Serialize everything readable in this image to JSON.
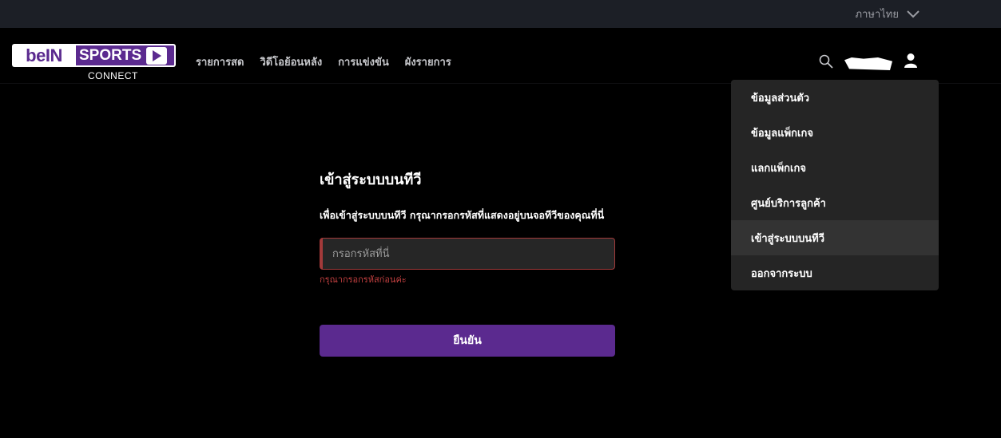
{
  "topbar": {
    "language": "ภาษาไทย"
  },
  "logo": {
    "left_text": "beIN",
    "right_text": "SPORTS",
    "sub_text": "CONNECT"
  },
  "nav": [
    {
      "label": "รายการสด"
    },
    {
      "label": "วิดีโอย้อนหลัง"
    },
    {
      "label": "การแข่งขัน"
    },
    {
      "label": "ผังรายการ"
    }
  ],
  "dropdown": [
    {
      "label": "ข้อมูลส่วนตัว"
    },
    {
      "label": "ข้อมูลแพ็กเกจ"
    },
    {
      "label": "แลกแพ็กเกจ"
    },
    {
      "label": "ศูนย์บริการลูกค้า"
    },
    {
      "label": "เข้าสู่ระบบบนทีวี"
    },
    {
      "label": "ออกจากระบบ"
    }
  ],
  "login": {
    "title": "เข้าสู่ระบบบนทีวี",
    "instruction": "เพื่อเข้าสู่ระบบบนทีวี กรุณากรอกรหัสที่แสดงอยู่บนจอทีวีของคุณที่นี่",
    "input_placeholder": "กรอกรหัสที่นี่",
    "error": "กรุณากรอกรหัสก่อนค่ะ",
    "confirm_label": "ยืนยัน"
  },
  "colors": {
    "brand_purple": "#5b2a8f",
    "error_red": "#c34040",
    "dropdown_bg": "#252525"
  }
}
